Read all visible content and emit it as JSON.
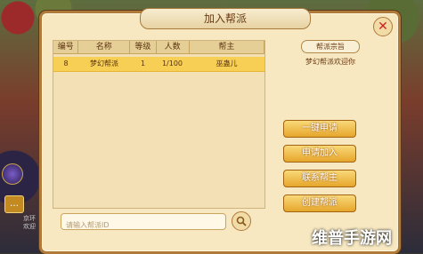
{
  "panel": {
    "title": "加入帮派"
  },
  "table": {
    "headers": [
      "编号",
      "名称",
      "等级",
      "人数",
      "帮主"
    ],
    "rows": [
      {
        "id": "8",
        "name": "梦幻帮派",
        "level": "1",
        "members": "1/100",
        "leader": "巫蛊儿"
      }
    ]
  },
  "side": {
    "declaration_label": "帮派宗旨",
    "declaration_text": "梦幻帮派欢迎你"
  },
  "buttons": {
    "one_click_apply": "一键申请",
    "apply_join": "申请加入",
    "contact_leader": "联系帮主",
    "create_guild": "创建帮派"
  },
  "search": {
    "placeholder": "请输入帮派ID"
  },
  "watermark": "维普手游网",
  "left_ui": {
    "line1": "京环",
    "line2": "欢迎"
  }
}
